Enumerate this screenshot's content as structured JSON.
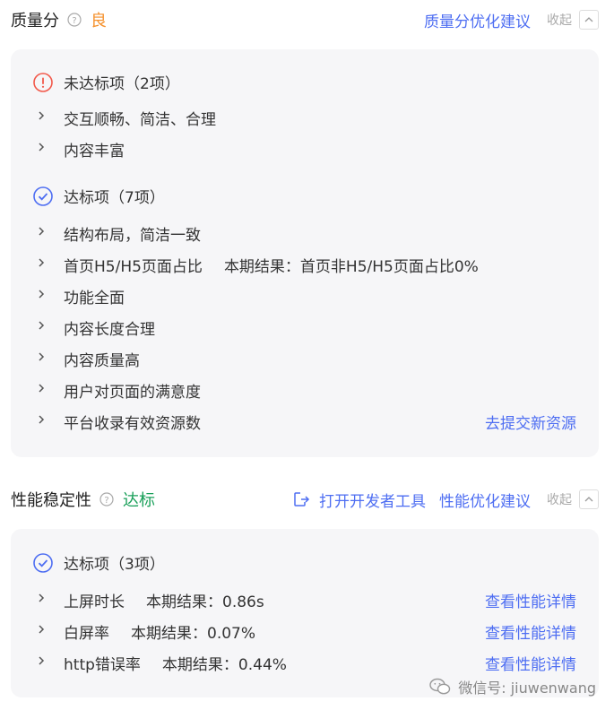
{
  "quality": {
    "title": "质量分",
    "rating": "良",
    "rating_color": "#f5912c",
    "optimize_link": "质量分优化建议",
    "collapse_label": "收起",
    "unmet": {
      "heading": "未达标项（2项）",
      "items": [
        "交互顺畅、简洁、合理",
        "内容丰富"
      ]
    },
    "met": {
      "heading": "达标项（7项）",
      "items": [
        {
          "label": "结构布局，简洁一致"
        },
        {
          "label": "首页H5/H5页面占比",
          "result": "本期结果：首页非H5/H5页面占比0%"
        },
        {
          "label": "功能全面"
        },
        {
          "label": "内容长度合理"
        },
        {
          "label": "内容质量高"
        },
        {
          "label": "用户对页面的满意度"
        },
        {
          "label": "平台收录有效资源数",
          "link": "去提交新资源"
        }
      ]
    }
  },
  "performance": {
    "title": "性能稳定性",
    "rating": "达标",
    "rating_color": "#1aa05a",
    "devtools_link": "打开开发者工具",
    "optimize_link": "性能优化建议",
    "collapse_label": "收起",
    "met": {
      "heading": "达标项（3项）",
      "items": [
        {
          "label": "上屏时长",
          "result": "本期结果：0.86s",
          "link": "查看性能详情"
        },
        {
          "label": "白屏率",
          "result": "本期结果：0.07%",
          "link": "查看性能详情"
        },
        {
          "label": "http错误率",
          "result": "本期结果：0.44%",
          "link": "查看性能详情"
        }
      ]
    }
  },
  "watermark": "微信号: jiuwenwang",
  "colors": {
    "link": "#4e6ef2",
    "error": "#f2594b",
    "success_icon": "#4e6ef2",
    "panel_bg": "#f6f6f8"
  }
}
